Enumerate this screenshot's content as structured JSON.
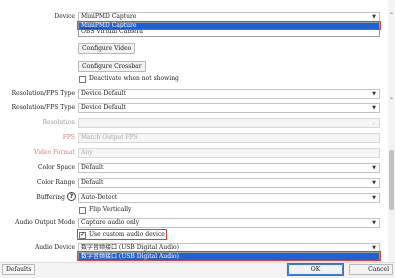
{
  "device": {
    "label": "Device",
    "value": "MiniPMD Capture",
    "options": [
      "MiniPMD Capture",
      "OBS Virtual Camera"
    ]
  },
  "buttons": {
    "configure_video": "Configure Video",
    "configure_crossbar": "Configure Crossbar"
  },
  "deactivate": {
    "label": "Deactivate when not showing",
    "checked": false
  },
  "rows": [
    {
      "label": "Resolution/FPS Type",
      "value": "Device Default",
      "disabled": false,
      "label_style": "normal"
    },
    {
      "label": "Resolution/FPS Type",
      "value": "Device Default",
      "disabled": false,
      "label_style": "normal"
    },
    {
      "label": "Resolution",
      "value": "",
      "disabled": true,
      "label_style": "disabled"
    },
    {
      "label": "FPS",
      "value": "Match Output FPS",
      "disabled": true,
      "label_style": "red"
    },
    {
      "label": "Video Format",
      "value": "Any",
      "disabled": true,
      "label_style": "red"
    },
    {
      "label": "Color Space",
      "value": "Default",
      "disabled": false,
      "label_style": "normal"
    },
    {
      "label": "Color Range",
      "value": "Default",
      "disabled": false,
      "label_style": "normal"
    },
    {
      "label": "Buffering",
      "value": "Auto-Detect",
      "disabled": false,
      "label_style": "normal"
    }
  ],
  "flip": {
    "label": "Flip Vertically",
    "checked": false
  },
  "audio_output_mode": {
    "label": "Audio Output Mode",
    "value": "Capture audio only"
  },
  "custom_audio": {
    "label": "Use custom audio device",
    "checked": true
  },
  "audio_device": {
    "label": "Audio Device",
    "value": "数字音频接口 (USB Digital Audio)",
    "options": [
      "数字音频接口 (USB Digital Audio)"
    ]
  },
  "footer": {
    "defaults": "Defaults",
    "ok": "OK",
    "cancel": "Cancel"
  },
  "colors": {
    "highlight": "#e53935",
    "selection": "#1e63d6"
  }
}
